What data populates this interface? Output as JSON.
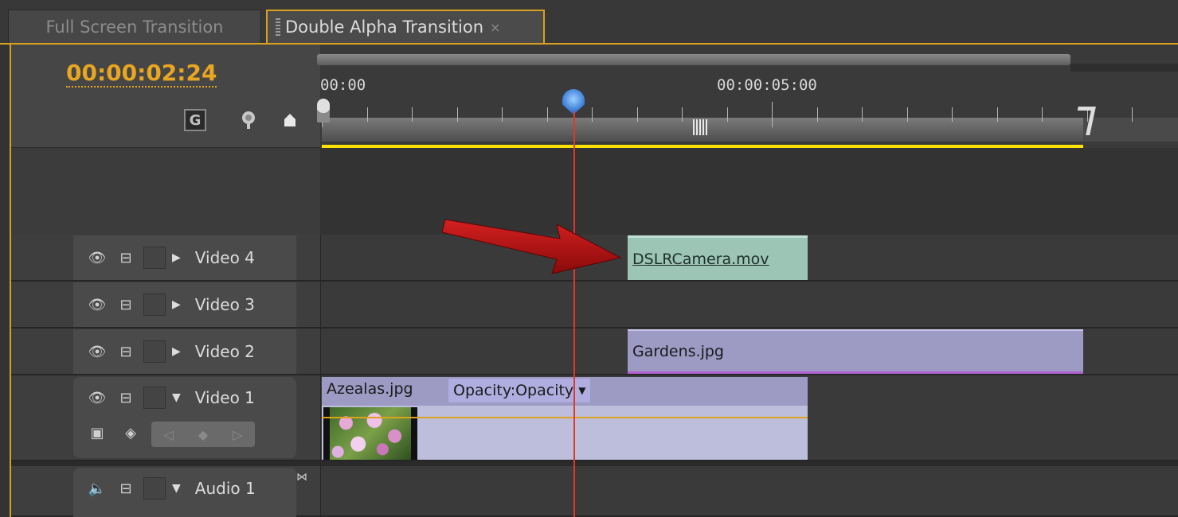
{
  "tabs": [
    {
      "label": "Full Screen Transition",
      "active": false
    },
    {
      "label": "Double Alpha Transition",
      "active": true,
      "close": "×"
    }
  ],
  "timeline": {
    "current_time": "00:00:02:24",
    "ruler_labels": [
      "00:00",
      "00:00:05:00"
    ],
    "accent_color": "#e9a721"
  },
  "tracks": [
    {
      "name": "Video 4",
      "type": "video",
      "expanded": false
    },
    {
      "name": "Video 3",
      "type": "video",
      "expanded": false
    },
    {
      "name": "Video 2",
      "type": "video",
      "expanded": false
    },
    {
      "name": "Video 1",
      "type": "video",
      "expanded": true
    },
    {
      "name": "Audio 1",
      "type": "audio",
      "expanded": true
    }
  ],
  "clips": {
    "dslr": "DSLRCamera.mov",
    "gardens": "Gardens.jpg",
    "azealas": "Azealas.jpg",
    "opacity_dropdown": "Opacity:Opacity"
  },
  "icons": {
    "snap": "snap-icon",
    "marker": "set-marker-icon",
    "keyframe": "keyframe-icon",
    "eye": "toggle-output-icon",
    "lock": "sync-lock-icon",
    "speaker": "speaker-icon"
  }
}
